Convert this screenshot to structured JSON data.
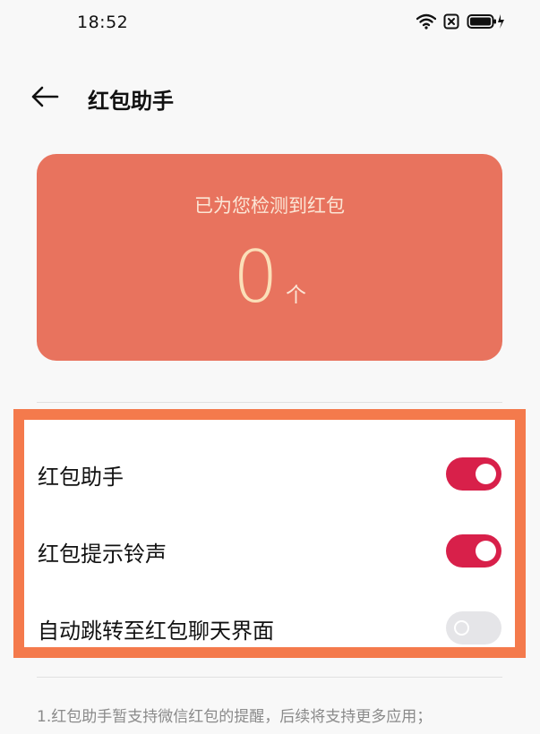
{
  "status_bar": {
    "time": "18:52",
    "icons": [
      "wifi-icon",
      "sim-icon",
      "battery-charging-icon"
    ]
  },
  "header": {
    "back_icon": "arrow-left-icon",
    "title": "红包助手"
  },
  "detect_card": {
    "label": "已为您检测到红包",
    "count": "0",
    "unit": "个",
    "background_color": "#e8735e"
  },
  "settings": {
    "items": [
      {
        "label": "红包助手",
        "enabled": true
      },
      {
        "label": "红包提示铃声",
        "enabled": true
      },
      {
        "label": "自动跳转至红包聊天界面",
        "enabled": false
      }
    ],
    "toggle_on_color": "#d8204a",
    "highlight_border_color": "#f47a4c"
  },
  "notes": {
    "line1": "1.红包助手暂支持微信红包的提醒，后续将支持更多应用；"
  }
}
